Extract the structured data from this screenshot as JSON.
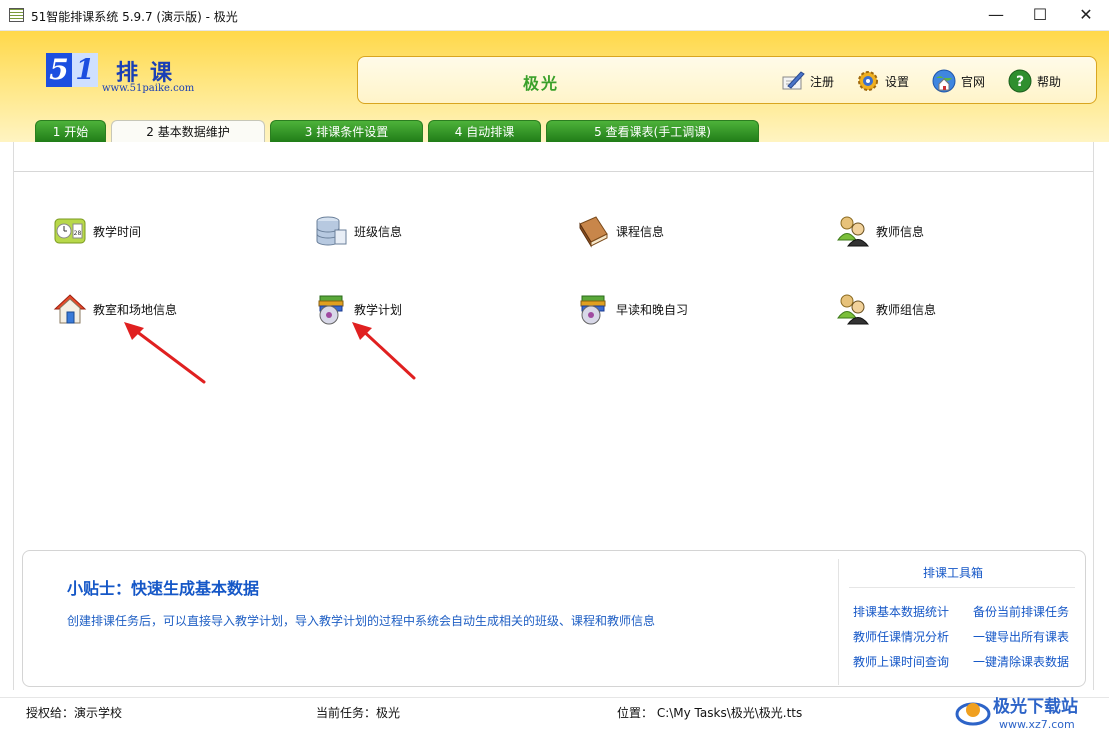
{
  "window": {
    "title": "51智能排课系统 5.9.7 (演示版) - 极光",
    "minimize": "—",
    "maximize": "☐",
    "close": "✕"
  },
  "logo": {
    "digit5": "5",
    "digit1": "1",
    "name": "排课",
    "url": "www.51paike.com"
  },
  "header": {
    "task_name": "极光",
    "buttons": [
      {
        "label": "注册",
        "icon": "register-icon"
      },
      {
        "label": "设置",
        "icon": "gear-icon"
      },
      {
        "label": "官网",
        "icon": "globe-home-icon"
      },
      {
        "label": "帮助",
        "icon": "help-icon"
      }
    ]
  },
  "tabs": [
    {
      "label": "1 开始"
    },
    {
      "label": "2 基本数据维护",
      "active": true
    },
    {
      "label": "3 排课条件设置"
    },
    {
      "label": "4 自动排课"
    },
    {
      "label": "5 查看课表(手工调课)"
    }
  ],
  "items": [
    {
      "label": "教学时间",
      "icon": "calendar-clock-icon"
    },
    {
      "label": "班级信息",
      "icon": "database-icon"
    },
    {
      "label": "课程信息",
      "icon": "book-icon"
    },
    {
      "label": "教师信息",
      "icon": "teachers-icon"
    },
    {
      "label": "教室和场地信息",
      "icon": "house-icon"
    },
    {
      "label": "教学计划",
      "icon": "books-disc-icon"
    },
    {
      "label": "早读和晚自习",
      "icon": "books-disc-icon"
    },
    {
      "label": "教师组信息",
      "icon": "teacher-group-icon"
    }
  ],
  "tips": {
    "headline": "小贴士：快速生成基本数据",
    "body": "创建排课任务后，可以直接导入教学计划，导入教学计划的过程中系统会自动生成相关的班级、课程和教师信息"
  },
  "toolbox": {
    "title": "排课工具箱",
    "links": [
      "排课基本数据统计",
      "备份当前排课任务",
      "教师任课情况分析",
      "一键导出所有课表",
      "教师上课时间查询",
      "一键清除课表数据"
    ]
  },
  "status": {
    "licensed": "授权给：演示学校",
    "current_task": "当前任务：极光",
    "location": "位置： C:\\My Tasks\\极光\\极光.tts"
  },
  "watermark": {
    "text": "极光下载站",
    "url": "www.xz7.com"
  },
  "colors": {
    "header_gold": "#ffd84a",
    "tab_green": "#2e8f22",
    "link_blue": "#1557c7",
    "annotation_red": "#e02020"
  }
}
